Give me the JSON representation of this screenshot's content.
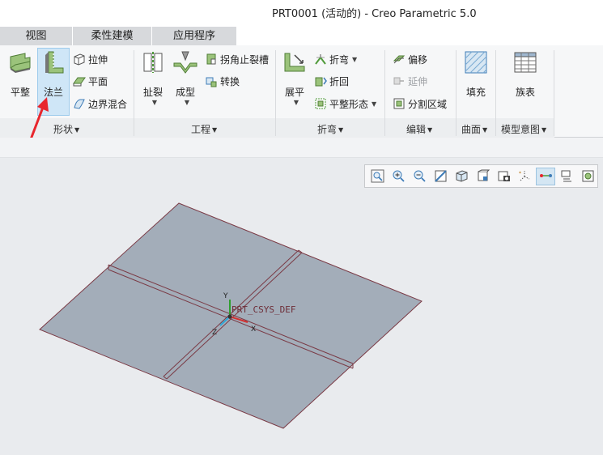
{
  "window": {
    "title": "PRT0001 (活动的) - Creo Parametric 5.0"
  },
  "tabs": [
    {
      "label": "视图"
    },
    {
      "label": "柔性建模"
    },
    {
      "label": "应用程序"
    }
  ],
  "ribbon": {
    "shape": {
      "group_label": "形状",
      "planar_label": "平整",
      "flange_label": "法兰",
      "extrude_label": "拉伸",
      "plane_label": "平面",
      "boundary_blend_label": "边界混合"
    },
    "engineering": {
      "group_label": "工程",
      "rip_label": "扯裂",
      "form_label": "成型",
      "corner_relief_label": "拐角止裂槽",
      "convert_label": "转换"
    },
    "bend": {
      "group_label": "折弯",
      "unbend_label": "展平",
      "bend_label": "折弯",
      "bend_back_label": "折回",
      "flatten_form_label": "平整形态"
    },
    "editing": {
      "group_label": "编辑",
      "offset_label": "偏移",
      "extend_label": "延伸",
      "split_area_label": "分割区域"
    },
    "surfaces": {
      "group_label": "曲面",
      "fill_label": "填充"
    },
    "model_intent": {
      "group_label": "模型意图",
      "family_table_label": "族表"
    }
  },
  "model": {
    "csys_label": "PRT_CSYS_DEF",
    "axis_x": "X",
    "axis_y": "Y",
    "axis_z": "Z",
    "plate_color": "#a3adb9",
    "edge_color": "#7a3a45"
  },
  "view_toolbar": {
    "buttons": [
      "refit-icon",
      "zoom-in-icon",
      "zoom-out-icon",
      "repaint-icon",
      "display-style-icon",
      "saved-orientations-icon",
      "view-manager-icon",
      "datum-display-icon",
      "spin-center-icon",
      "annotation-display-icon",
      "appearance-icon"
    ]
  },
  "accent": "#e8262d"
}
